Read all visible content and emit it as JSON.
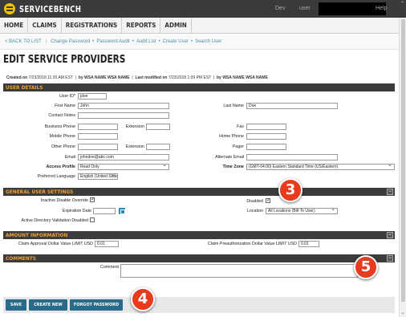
{
  "app": {
    "brand": "SERVICEBENCH",
    "env": "Dev",
    "user_label": "user",
    "help": "Help"
  },
  "nav": {
    "items": [
      "HOME",
      "CLAIMS",
      "REGISTRATIONS",
      "REPORTS",
      "ADMIN"
    ]
  },
  "subnav": {
    "back": "< BACK TO LIST",
    "links": [
      "Change Password",
      "Password Audit",
      "Audit List",
      "Create User",
      "Search User"
    ]
  },
  "page": {
    "title": "EDIT SERVICE PROVIDERS",
    "created_label": "Created on",
    "created_value": "7/23/2018 11:20 AM EST",
    "by1": "by WSA NAME WSA NAME",
    "modified_label": "Last modified on",
    "modified_value": "7/23/2018 1:09 PM EST",
    "by2": "by WSA NAME WSA NAME"
  },
  "user_details": {
    "header": "USER DETAILS",
    "user_id_label": "User ID*",
    "user_id": "jdoe",
    "first_name_label": "First Name",
    "first_name": "John",
    "last_name_label": "Last Name",
    "last_name": "Doe",
    "contact_notes_label": "Contact Notes",
    "contact_notes": "",
    "business_phone_label": "Business Phone",
    "business_phone": "",
    "extension_label": "Extension",
    "extension1": "",
    "fax_label": "Fax",
    "fax": "",
    "mobile_phone_label": "Mobile Phone",
    "mobile_phone": "",
    "home_phone_label": "Home Phone",
    "home_phone": "",
    "other_phone_label": "Other Phone",
    "other_phone": "",
    "extension2": "",
    "pager_label": "Pager",
    "pager": "",
    "email_label": "Email",
    "email": "johndoe@abc.com",
    "alt_email_label": "Alternate Email",
    "alt_email": "",
    "access_profile_label": "Access Profile",
    "access_profile": "Read Only",
    "time_zone_label": "Time Zone",
    "time_zone": "(GMT-04:00) Eastern Standard Time (US/Eastern)",
    "pref_lang_label": "Preferred Language",
    "pref_lang": "English (United States)"
  },
  "general": {
    "header": "GENERAL USER SETTINGS",
    "inactive_override_label": "Inactive Disable Override",
    "inactive_override_checked": true,
    "disabled_label": "Disabled",
    "disabled_checked": true,
    "expiration_label": "Expiration Date",
    "expiration": "",
    "location_label": "Location",
    "location": "All Locations (Bill-To User)",
    "ad_validation_label": "Active Directory Validation Disabled",
    "ad_validation_checked": false,
    "collapse_label": "−"
  },
  "amount": {
    "header": "AMOUNT INFORMATION",
    "claim_approval_label": "Claim Approval Dollar Value LIMIT USD",
    "claim_approval": "0.01",
    "claim_preauth_label": "Claim Preauthorization Dollar Value LIMIT USD",
    "claim_preauth": "0.01",
    "collapse_label": "−"
  },
  "comments": {
    "header": "COMMENTS",
    "comment_label": "Comment",
    "comment": "",
    "collapse_label": "−"
  },
  "footer": {
    "save": "SAVE",
    "create_new": "CREATE NEW",
    "forgot_password": "FORGOT PASSWORD"
  },
  "annotations": {
    "badge3": "3",
    "badge4": "4",
    "badge5": "5"
  },
  "colors": {
    "accent": "#f0a030",
    "button": "#2a6a8a",
    "badge": "#e83a1c"
  }
}
